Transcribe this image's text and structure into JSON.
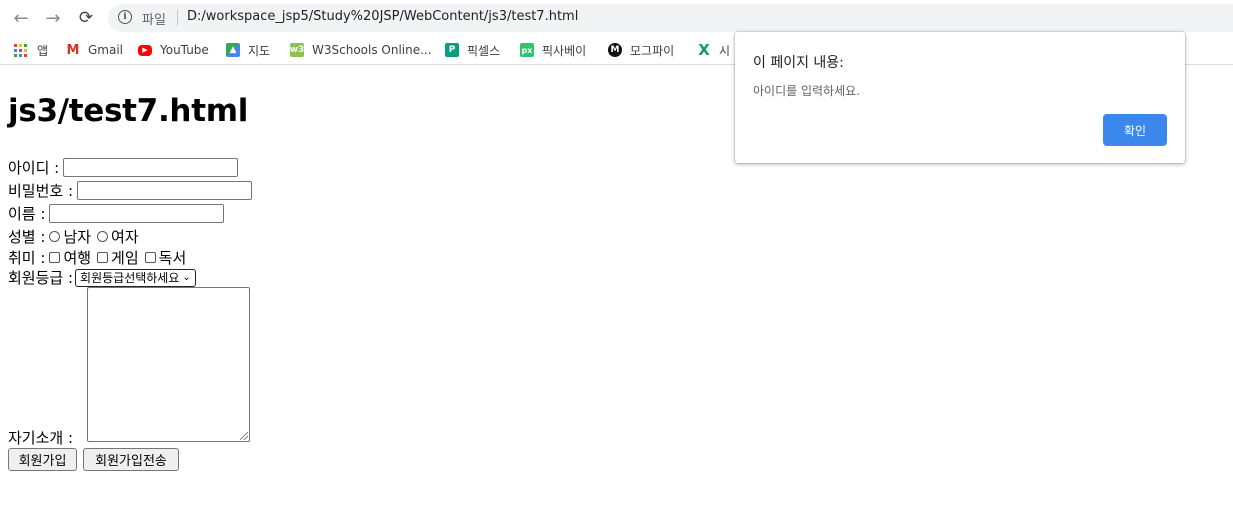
{
  "browser": {
    "scheme_label": "파일",
    "url": "D:/workspace_jsp5/Study%20JSP/WebContent/js3/test7.html"
  },
  "bookmarks": [
    {
      "label": "앱",
      "icon": "apps-grid-icon"
    },
    {
      "label": "Gmail",
      "icon": "gmail-icon"
    },
    {
      "label": "YouTube",
      "icon": "youtube-icon"
    },
    {
      "label": "지도",
      "icon": "maps-icon"
    },
    {
      "label": "W3Schools Online...",
      "icon": "w3schools-icon"
    },
    {
      "label": "픽셀스",
      "icon": "pexels-icon"
    },
    {
      "label": "픽사베이",
      "icon": "pixabay-icon"
    },
    {
      "label": "모그파이",
      "icon": "mogfi-icon"
    },
    {
      "label": "시",
      "icon": "x-icon"
    }
  ],
  "page": {
    "heading": "js3/test7.html",
    "id_label": "아이디 :",
    "pw_label": "비밀번호 :",
    "name_label": "이름 :",
    "gender_label": "성별 :",
    "gender_options": [
      "남자",
      "여자"
    ],
    "hobby_label": "취미 :",
    "hobby_options": [
      "여행",
      "게임",
      "독서"
    ],
    "grade_label": "회원등급 :",
    "grade_selected": "회원등급선택하세요",
    "intro_label": "자기소개 :",
    "join_button": "회원가입",
    "join_send_button": "회원가입전송"
  },
  "dialog": {
    "title": "이 페이지 내용:",
    "message": "아이디를 입력하세요.",
    "ok_label": "확인"
  },
  "colors": {
    "dialog_button": "#1a73e8",
    "youtube": "#ff0000",
    "gmail": "#d93025"
  }
}
